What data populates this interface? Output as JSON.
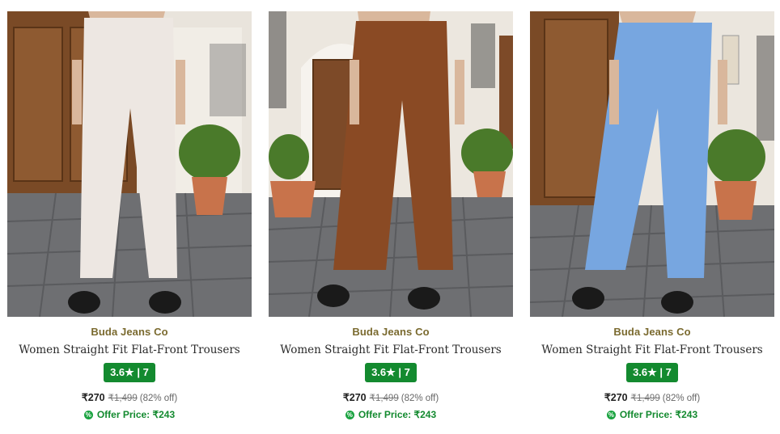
{
  "products": [
    {
      "brand": "Buda Jeans Co",
      "title": "Women Straight Fit Flat-Front Trousers",
      "rating_label": "3.6★ | 7",
      "rating": 3.6,
      "rating_count": 7,
      "price": "₹270",
      "mrp": "₹1,499",
      "discount": "(82% off)",
      "offer_icon": "%",
      "offer_label": "Offer Price: ₹243",
      "trouser_color": "#ede7e2",
      "image_icon": "product-photo-white-trousers"
    },
    {
      "brand": "Buda Jeans Co",
      "title": "Women Straight Fit Flat-Front Trousers",
      "rating_label": "3.6★ | 7",
      "rating": 3.6,
      "rating_count": 7,
      "price": "₹270",
      "mrp": "₹1,499",
      "discount": "(82% off)",
      "offer_icon": "%",
      "offer_label": "Offer Price: ₹243",
      "trouser_color": "#8a4a24",
      "image_icon": "product-photo-brown-trousers"
    },
    {
      "brand": "Buda Jeans Co",
      "title": "Women Straight Fit Flat-Front Trousers",
      "rating_label": "3.6★ | 7",
      "rating": 3.6,
      "rating_count": 7,
      "price": "₹270",
      "mrp": "₹1,499",
      "discount": "(82% off)",
      "offer_icon": "%",
      "offer_label": "Offer Price: ₹243",
      "trouser_color": "#77a6e0",
      "image_icon": "product-photo-blue-trousers"
    }
  ],
  "colors": {
    "rating_badge": "#138a2f",
    "brand_text": "#7a6a2f",
    "offer_text": "#138a2f"
  }
}
